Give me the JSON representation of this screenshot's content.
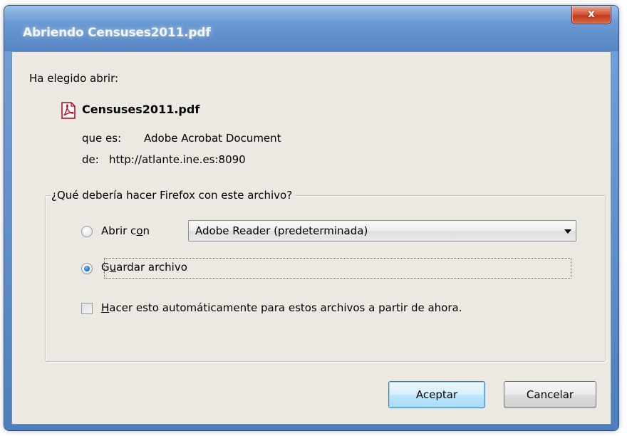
{
  "window": {
    "title": "Abriendo Censuses2011.pdf",
    "close_label": "x"
  },
  "dialog": {
    "intro": "Ha elegido abrir:",
    "filename": "Censuses2011.pdf",
    "type_label": "que es:",
    "type_value": "Adobe Acrobat Document",
    "from_label": "de:",
    "from_value": "http://atlante.ine.es:8090"
  },
  "action_group": {
    "legend": "¿Qué debería hacer Firefox con este archivo?",
    "open_with_label_a": "Abrir c",
    "open_with_label_u": "o",
    "open_with_label_b": "n",
    "open_with_checked": false,
    "open_with_app": "Adobe Reader  (predeterminada)",
    "save_label_a": "G",
    "save_label_u": "u",
    "save_label_b": "ardar archivo",
    "save_checked": true,
    "auto_label_u": "H",
    "auto_label_b": "acer esto automáticamente para estos archivos a partir de ahora.",
    "auto_checked": false
  },
  "buttons": {
    "ok": "Aceptar",
    "cancel": "Cancelar"
  },
  "colors": {
    "title_bar": "#6b9bd4",
    "client_bg": "#ebe9e2",
    "close_button": "#d6583a",
    "radio_dot": "#1d73c4",
    "default_button": "#bee6fd"
  },
  "icons": {
    "file_type": "pdf-file-icon",
    "close": "close-icon",
    "dropdown": "chevron-down-icon"
  }
}
